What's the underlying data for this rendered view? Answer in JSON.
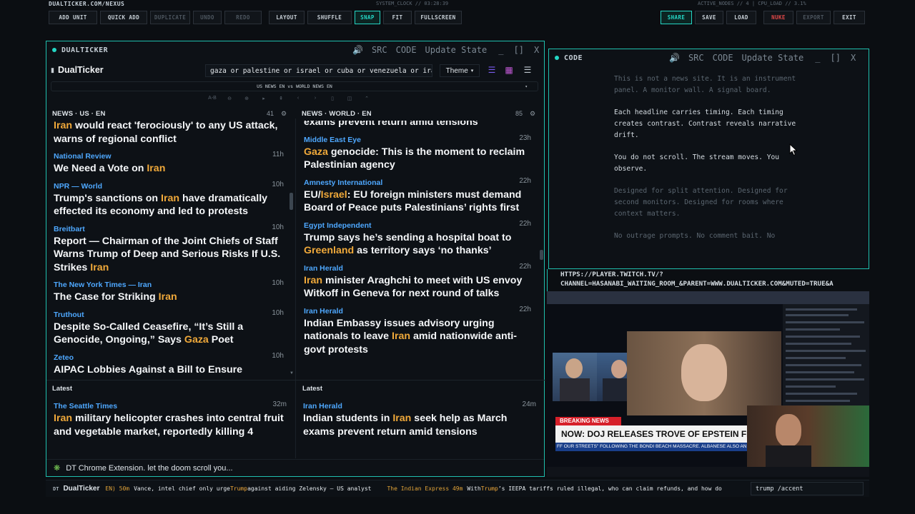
{
  "topbar": {
    "site": "DUALTICKER.COM/NEXUS",
    "clock": "SYSTEM_CLOCK // 03:28:39",
    "status": "ACTIVE_NODES // 4 | CPU_LOAD // 3.1%",
    "buttons": [
      "ADD UNIT",
      "QUICK ADD",
      "DUPLICATE",
      "UNDO",
      "REDO",
      "LAYOUT",
      "SHUFFLE",
      "SNAP",
      "FIT",
      "FULLSCREEN"
    ],
    "right_buttons": [
      "SHARE",
      "SAVE",
      "LOAD",
      "NUKE",
      "EXPORT",
      "EXIT"
    ]
  },
  "panel_controls": {
    "src": "SRC",
    "code": "CODE",
    "update": "Update State",
    "min": "_",
    "max": "[]",
    "close": "X"
  },
  "dualticker": {
    "title": "DUALTICKER",
    "logo": "DualTicker",
    "search": "gaza or palestine or israel or cuba or venezuela or iran",
    "theme": "Theme",
    "dropdown": "US NEWS EN vs WORLD NEWS EN",
    "tools": [
      "A-B",
      "⊖",
      "⊕",
      "▸",
      "⇞",
      "‹",
      "›",
      "▯",
      "◫",
      "⌃"
    ],
    "left_col": {
      "head": "NEWS · US · EN",
      "count": "41",
      "items": [
        {
          "source": "",
          "time": "",
          "pre": "",
          "kw": "Iran",
          "post": " would react 'ferociously' to any US attack, warns of regional conflict"
        },
        {
          "source": "National Review",
          "time": "11h",
          "pre": "We Need a Vote on ",
          "kw": "Iran",
          "post": ""
        },
        {
          "source": "NPR — World",
          "time": "10h",
          "pre": "Trump's sanctions on ",
          "kw": "Iran",
          "post": " have dramatically effected its economy and led to protests"
        },
        {
          "source": "Breitbart",
          "time": "10h",
          "pre": "Report — Chairman of the Joint Chiefs of Staff Warns Trump of Deep and Serious Risks If U.S. Strikes ",
          "kw": "Iran",
          "post": ""
        },
        {
          "source": "The New York Times — Iran",
          "time": "10h",
          "pre": "The Case for Striking ",
          "kw": "Iran",
          "post": ""
        },
        {
          "source": "Truthout",
          "time": "10h",
          "pre": "Despite So-Called Ceasefire, “It’s Still a Genocide, Ongoing,” Says ",
          "kw": "Gaza",
          "post": " Poet"
        },
        {
          "source": "Zeteo",
          "time": "10h",
          "pre": "AIPAC Lobbies Against a Bill to Ensure",
          "kw": "",
          "post": ""
        }
      ],
      "latest_label": "Latest",
      "latest": {
        "source": "The Seattle Times",
        "time": "32m",
        "pre": "",
        "kw": "Iran",
        "post": " military helicopter crashes into central fruit and vegetable market, reportedly killing 4"
      }
    },
    "right_col": {
      "head": "NEWS · WORLD · EN",
      "count": "85",
      "items": [
        {
          "source": "",
          "time": "",
          "pre": "exams prevent return amid tensions",
          "kw": "",
          "post": ""
        },
        {
          "source": "Middle East Eye",
          "time": "23h",
          "pre": "",
          "kw": "Gaza",
          "post": " genocide: This is the moment to reclaim Palestinian agency"
        },
        {
          "source": "Amnesty International",
          "time": "22h",
          "pre": "EU/",
          "kw": "Israel",
          "post": ": EU foreign ministers must demand Board of Peace puts Palestinians’ rights first"
        },
        {
          "source": "Egypt Independent",
          "time": "22h",
          "pre": "Trump says he’s sending a hospital boat to ",
          "kw": "Greenland",
          "post": " as territory says ‘no thanks’"
        },
        {
          "source": "Iran Herald",
          "time": "22h",
          "pre": "",
          "kw": "Iran",
          "post": " minister Araghchi to meet with US envoy Witkoff in Geneva for next round of talks"
        },
        {
          "source": "Iran Herald",
          "time": "22h",
          "pre": "Indian Embassy issues advisory urging nationals to leave ",
          "kw": "Iran",
          "post": " amid nationwide anti-govt protests"
        }
      ],
      "latest_label": "Latest",
      "latest": {
        "source": "Iran Herald",
        "time": "24m",
        "pre": "Indian students in ",
        "kw": "Iran",
        "post": " seek help as March exams prevent return amid tensions"
      }
    },
    "footer": "DT Chrome Extension. let the doom scroll you..."
  },
  "code_panel": {
    "title": "CODE",
    "paragraphs": [
      {
        "text": "This is not a news site. It is an instrument panel. A monitor wall. A signal board.",
        "faded": true
      },
      {
        "text": "Each headline carries timing. Each timing creates contrast. Contrast reveals narrative drift.",
        "faded": false
      },
      {
        "text": "You do not scroll. The stream moves. You observe.",
        "faded": false
      },
      {
        "text": "Designed for split attention. Designed for second monitors. Designed for rooms where context matters.",
        "faded": true
      },
      {
        "text": "No outrage prompts. No comment bait. No",
        "faded": true
      }
    ]
  },
  "twitch": {
    "url_line1": "HTTPS://PLAYER.TWITCH.TV/?",
    "url_line2": "CHANNEL=HASANABI_WAITING_ROOM_&PARENT=WWW.DUALTICKER.COM&MUTED=TRUE&A",
    "breaking": "BREAKING NEWS",
    "headline": "NOW: DOJ RELEASES TROVE OF EPSTEIN FILES",
    "crawl": "FF OUR STREETS\" FOLLOWING THE BONDI BEACH MASSACRE. ALBANESE ALSO ANNO"
  },
  "ticker": {
    "logo": "DualTicker",
    "items": [
      {
        "tag": "EN) 50m",
        "text": "Vance, intel chief only urge ",
        "kw": "Trump",
        "post": " against aiding Zelensky — US analyst"
      },
      {
        "tag": "The Indian Express 49m",
        "text": "With ",
        "kw": "Trump",
        "post": "’s IEEPA tariffs ruled illegal, who can claim refunds, and how do"
      }
    ],
    "input": "trump /accent"
  }
}
